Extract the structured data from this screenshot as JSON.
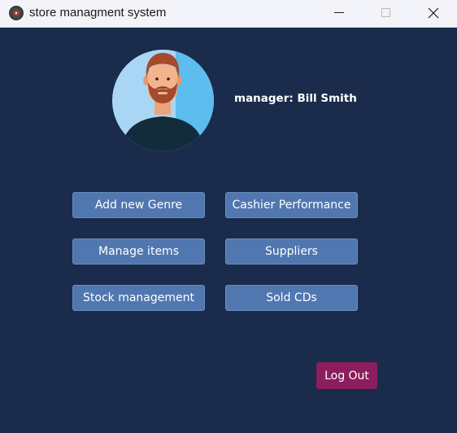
{
  "window": {
    "title": "store managment system",
    "app_icon": "cd-disc-icon",
    "controls": {
      "minimize": "minimize-icon",
      "maximize": "maximize-icon",
      "close": "close-icon"
    }
  },
  "profile": {
    "avatar": "manager-avatar",
    "manager_label": "manager: Bill Smith"
  },
  "menu": {
    "buttons": [
      {
        "label": "Add new Genre"
      },
      {
        "label": "Cashier Performance"
      },
      {
        "label": "Manage items"
      },
      {
        "label": "Suppliers"
      },
      {
        "label": "Stock management"
      },
      {
        "label": "Sold CDs"
      }
    ]
  },
  "logout": {
    "label": "Log Out"
  },
  "colors": {
    "background": "#1a2b4b",
    "button": "#5077b0",
    "logout": "#8c1e5d",
    "titlebar": "#f3f4f9"
  }
}
